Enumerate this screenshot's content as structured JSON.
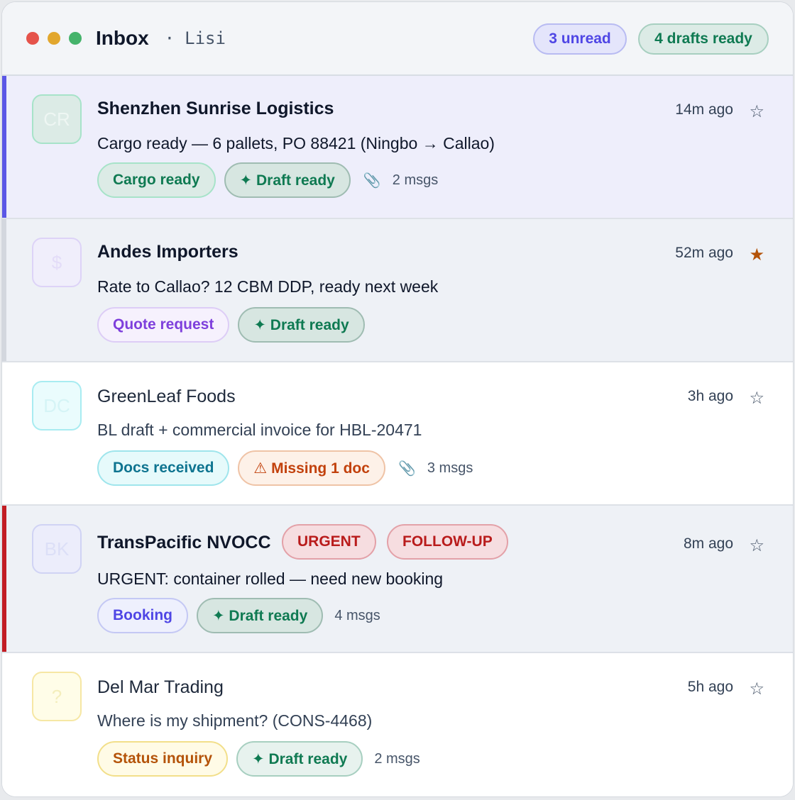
{
  "header": {
    "title": "Inbox",
    "separator": "·",
    "user": "Lisi",
    "unread_badge": "3 unread",
    "drafts_badge": "4 drafts ready"
  },
  "colors": {
    "accent": "#5b57e6",
    "urgent": "#b91c1c",
    "green": "#0f7a52",
    "star_active": "#b45309"
  },
  "messages": [
    {
      "avatar": "CR",
      "sender": "Shenzhen Sunrise Logistics",
      "subject": "Cargo ready — 6 pallets, PO 88421 (Ningbo → Callao)",
      "time": "14m ago",
      "star": "☆",
      "starred": false,
      "unread": true,
      "tags": [
        "Cargo ready",
        "✦ Draft ready"
      ],
      "attachment_icon": "paperclip-icon",
      "msgs": "2 msgs"
    },
    {
      "avatar": "$",
      "sender": "Andes Importers",
      "subject": "Rate to Callao? 12 CBM DDP, ready next week",
      "time": "52m ago",
      "star": "★",
      "starred": true,
      "unread": true,
      "tags": [
        "Quote request",
        "✦ Draft ready"
      ]
    },
    {
      "avatar": "DC",
      "sender": "GreenLeaf Foods",
      "subject": "BL draft + commercial invoice for HBL-20471",
      "time": "3h ago",
      "star": "☆",
      "starred": false,
      "unread": false,
      "tags": [
        "Docs received",
        "⚠ Missing 1 doc"
      ],
      "attachment_icon": "paperclip-icon",
      "msgs": "3 msgs"
    },
    {
      "avatar": "BK",
      "sender": "TransPacific NVOCC",
      "flags": [
        "URGENT",
        "FOLLOW-UP"
      ],
      "subject": "URGENT: container rolled — need new booking",
      "time": "8m ago",
      "star": "☆",
      "starred": false,
      "unread": true,
      "tags": [
        "Booking",
        "✦ Draft ready"
      ],
      "msgs": "4 msgs"
    },
    {
      "avatar": "?",
      "sender": "Del Mar Trading",
      "subject": "Where is my shipment? (CONS-4468)",
      "time": "5h ago",
      "star": "☆",
      "starred": false,
      "unread": false,
      "tags": [
        "Status inquiry",
        "✦ Draft ready"
      ],
      "msgs": "2 msgs"
    }
  ]
}
